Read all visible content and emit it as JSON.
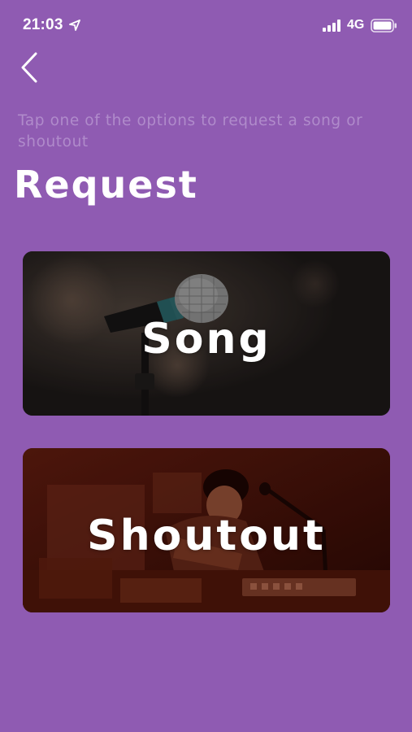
{
  "status_bar": {
    "time": "21:03",
    "network": "4G",
    "icons": [
      "location-arrow-icon",
      "signal-bars-icon",
      "battery-icon"
    ]
  },
  "nav": {
    "back_icon": "chevron-left-icon"
  },
  "subtitle": "Tap one of the options to request a song or shoutout",
  "title": "Request",
  "options": [
    {
      "label": "Song",
      "image": "microphone-photo"
    },
    {
      "label": "Shoutout",
      "image": "dj-performer-photo"
    }
  ],
  "colors": {
    "background": "#8f5bb2",
    "subtitle_text": "#b08bcb",
    "song_card_tint": "#211d1c",
    "shoutout_card_tint": "#3a0d07"
  }
}
